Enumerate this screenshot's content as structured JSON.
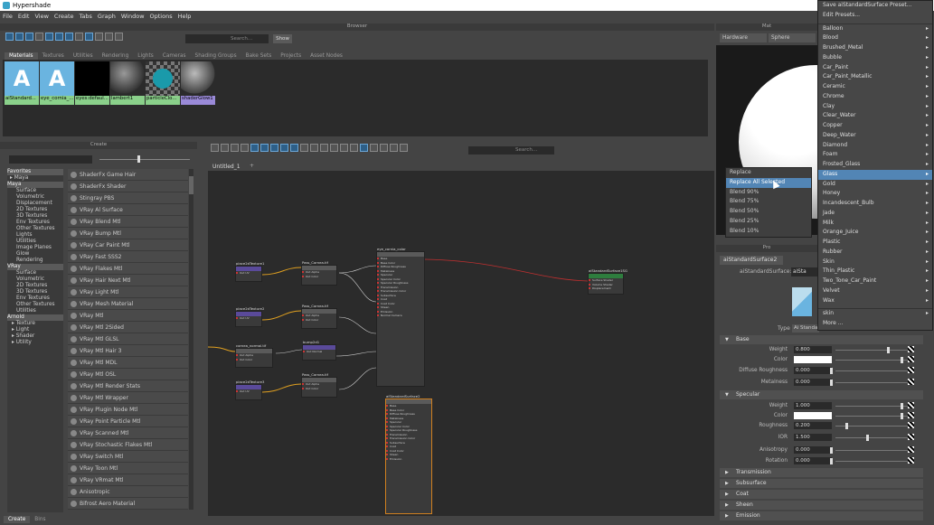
{
  "window": {
    "title": "Hypershade"
  },
  "menu": [
    "File",
    "Edit",
    "View",
    "Create",
    "Tabs",
    "Graph",
    "Window",
    "Options",
    "Help"
  ],
  "browser": {
    "header": "Browser",
    "search_placeholder": "Search...",
    "show_label": "Show",
    "tabs": [
      "Materials",
      "Textures",
      "Utilities",
      "Rendering",
      "Lights",
      "Cameras",
      "Shading Groups",
      "Bake Sets",
      "Projects",
      "Asset Nodes"
    ],
    "swatches": [
      {
        "label": "aiStandard...",
        "kind": "ai"
      },
      {
        "label": "eye_cornia_...",
        "kind": "ai"
      },
      {
        "label": "eyes:defaul...",
        "kind": "black"
      },
      {
        "label": "lambert1",
        "kind": "sphere"
      },
      {
        "label": "particleClo...",
        "kind": "checker"
      },
      {
        "label": "shaderGlow1",
        "kind": "glow"
      }
    ]
  },
  "create": {
    "header": "Create",
    "tree": [
      {
        "label": "Favorites",
        "grp": true
      },
      {
        "label": "▸ Maya",
        "grp": false
      },
      {
        "label": "Maya",
        "grp": true
      },
      {
        "label": "Surface",
        "grp": false
      },
      {
        "label": "Volumetric",
        "grp": false
      },
      {
        "label": "Displacement",
        "grp": false
      },
      {
        "label": "2D Textures",
        "grp": false
      },
      {
        "label": "3D Textures",
        "grp": false
      },
      {
        "label": "Env Textures",
        "grp": false
      },
      {
        "label": "Other Textures",
        "grp": false
      },
      {
        "label": "Lights",
        "grp": false
      },
      {
        "label": "Utilities",
        "grp": false
      },
      {
        "label": "Image Planes",
        "grp": false
      },
      {
        "label": "Glow",
        "grp": false
      },
      {
        "label": "Rendering",
        "grp": false
      },
      {
        "label": "VRay",
        "grp": true
      },
      {
        "label": "Surface",
        "grp": false
      },
      {
        "label": "Volumetric",
        "grp": false
      },
      {
        "label": "2D Textures",
        "grp": false
      },
      {
        "label": "3D Textures",
        "grp": false
      },
      {
        "label": "Env Textures",
        "grp": false
      },
      {
        "label": "Other Textures",
        "grp": false
      },
      {
        "label": "Utilities",
        "grp": false
      },
      {
        "label": "Arnold",
        "grp": true
      },
      {
        "label": "▸ Texture",
        "grp": false
      },
      {
        "label": "▸ Light",
        "grp": false
      },
      {
        "label": "▸ Shader",
        "grp": false
      },
      {
        "label": "▸ Utility",
        "grp": false
      }
    ],
    "nodes": [
      "ShaderFx Game Hair",
      "ShaderFx Shader",
      "Stingray PBS",
      "VRay Al Surface",
      "VRay Blend Mtl",
      "VRay Bump Mtl",
      "VRay Car Paint Mtl",
      "VRay Fast SSS2",
      "VRay Flakes Mtl",
      "VRay Hair Next Mtl",
      "VRay Light Mtl",
      "VRay Mesh Material",
      "VRay Mtl",
      "VRay Mtl 2Sided",
      "VRay Mtl GLSL",
      "VRay Mtl Hair 3",
      "VRay Mtl MDL",
      "VRay Mtl OSL",
      "VRay Mtl Render Stats",
      "VRay Mtl Wrapper",
      "VRay Plugin Node Mtl",
      "VRay Point Particle Mtl",
      "VRay Scanned Mtl",
      "VRay Stochastic Flakes Mtl",
      "VRay Switch Mtl",
      "VRay Toon Mtl",
      "VRay VRmat Mtl",
      "Anisotropic",
      "Bifrost Aero Material"
    ]
  },
  "bottom_tabs": [
    "Create",
    "Bins"
  ],
  "graph": {
    "tab": "Untitled_1",
    "search_placeholder": "Search...",
    "nodes": [
      {
        "title": "place2dTexture1",
        "type": "util"
      },
      {
        "title": "place2dTexture2",
        "type": "util"
      },
      {
        "title": "cornea_normal.tif",
        "type": "sh"
      },
      {
        "title": "place2dTexture3",
        "type": "util"
      },
      {
        "title": "Pass_Cornea.tif",
        "type": "sh"
      },
      {
        "title": "Pass_Cornea.tif",
        "type": "sh"
      },
      {
        "title": "bump2d1",
        "type": "util"
      },
      {
        "title": "Pass_Cornea.tif",
        "type": "sh"
      },
      {
        "title": "eye_cornia_color",
        "type": "sh"
      },
      {
        "title": "aiStandardSurface1SG",
        "type": "sg"
      },
      {
        "title": "aiStandardSurface2",
        "type": "sh"
      }
    ]
  },
  "material_viewer": {
    "header": "Mat",
    "renderer": "Hardware",
    "shape": "Sphere"
  },
  "attr_editor": {
    "header": "Pro",
    "tab": "aiStandardSurface2",
    "node_label": "aiStandardSurface:",
    "node_value": "aiSta",
    "type_label": "Type",
    "type_value": "Ai Standard Surface",
    "sections": {
      "base": "Base",
      "specular": "Specular",
      "transmission": "Transmission",
      "subsurface": "Subsurface",
      "coat": "Coat",
      "sheen": "Sheen",
      "emission": "Emission"
    },
    "rows": [
      {
        "label": "Weight",
        "value": "0.800",
        "slider": 0.8
      },
      {
        "label": "Color",
        "value": "",
        "slider": 1.0
      },
      {
        "label": "Diffuse Roughness",
        "value": "0.000",
        "slider": 0.0
      },
      {
        "label": "Metalness",
        "value": "0.000",
        "slider": 0.0
      },
      {
        "label": "Weight",
        "value": "1.000",
        "slider": 1.0
      },
      {
        "label": "Color",
        "value": "",
        "slider": 1.0
      },
      {
        "label": "Roughness",
        "value": "0.200",
        "slider": 0.2
      },
      {
        "label": "IOR",
        "value": "1.500",
        "slider": 0.5
      },
      {
        "label": "Anisotropy",
        "value": "0.000",
        "slider": 0.0
      },
      {
        "label": "Rotation",
        "value": "0.000",
        "slider": 0.0
      }
    ]
  },
  "blend_menu": [
    "Replace",
    "Replace All Selected",
    "Blend 90%",
    "Blend 75%",
    "Blend 50%",
    "Blend 25%",
    "Blend 10%"
  ],
  "preset_menu": {
    "top": [
      "Save aiStandardSurface Preset...",
      "Edit Presets..."
    ],
    "items": [
      "Balloon",
      "Blood",
      "Brushed_Metal",
      "Bubble",
      "Car_Paint",
      "Car_Paint_Metallic",
      "Ceramic",
      "Chrome",
      "Clay",
      "Clear_Water",
      "Copper",
      "Deep_Water",
      "Diamond",
      "Foam",
      "Frosted_Glass",
      "Glass",
      "Gold",
      "Honey",
      "Incandescent_Bulb",
      "Jade",
      "Milk",
      "Orange_Juice",
      "Plastic",
      "Rubber",
      "Skin",
      "Thin_Plastic",
      "Two_Tone_Car_Paint",
      "Velvet",
      "Wax"
    ],
    "bottom": [
      "skin",
      "More ..."
    ]
  }
}
